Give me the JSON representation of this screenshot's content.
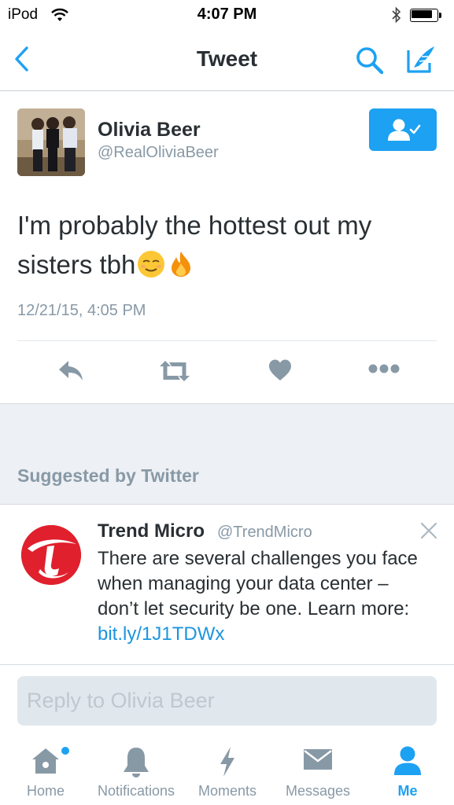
{
  "status_bar": {
    "carrier": "iPod",
    "time": "4:07 PM"
  },
  "nav": {
    "title": "Tweet",
    "back_icon": "chevron-left-icon",
    "search_icon": "search-icon",
    "compose_icon": "compose-icon"
  },
  "tweet": {
    "author_name": "Olivia Beer",
    "author_handle": "@RealOliviaBeer",
    "text": "I'm probably the hottest out my sisters tbh",
    "emojis": [
      "relieved-face",
      "fire"
    ],
    "timestamp": "12/21/15, 4:05 PM",
    "following": true
  },
  "actions": [
    "reply-icon",
    "retweet-icon",
    "like-icon",
    "more-icon"
  ],
  "suggested": {
    "label": "Suggested by Twitter",
    "name": "Trend Micro",
    "handle": "@TrendMicro",
    "text": "There are several challenges you face when managing your data center – don’t let security be one. Learn more: ",
    "link": "bit.ly/1J1TDWx"
  },
  "reply": {
    "placeholder": "Reply to Olivia Beer"
  },
  "tabs": [
    {
      "label": "Home",
      "icon": "home-icon",
      "active": false,
      "badge": true
    },
    {
      "label": "Notifications",
      "icon": "bell-icon",
      "active": false
    },
    {
      "label": "Moments",
      "icon": "lightning-icon",
      "active": false
    },
    {
      "label": "Messages",
      "icon": "envelope-icon",
      "active": false
    },
    {
      "label": "Me",
      "icon": "person-icon",
      "active": true
    }
  ],
  "colors": {
    "accent": "#1da1f2",
    "secondary_text": "#8899a6",
    "primary_text": "#292f33",
    "link": "#1b95e0"
  }
}
